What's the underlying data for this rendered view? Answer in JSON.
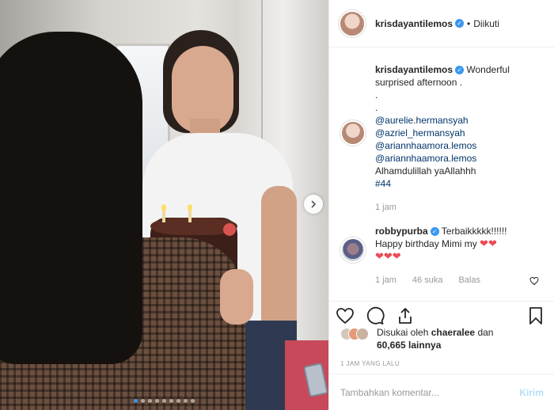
{
  "post": {
    "author": "krisdayantilemos",
    "separator": "•",
    "follow_status": "Diikuti"
  },
  "caption": {
    "author": "krisdayantilemos",
    "text": "Wonderful surprised afternoon .",
    "dot1": ".",
    "dot2": ".",
    "mentions": [
      "@aurelie.hermansyah",
      "@azriel_hermansyah",
      "@ariannhaamora.lemos",
      "@ariannhaamora.lemos"
    ],
    "line_after": "Alhamdulillah yaAllahhh",
    "hashtag": "#44",
    "time": "1 jam"
  },
  "comment": {
    "author": "robbypurba",
    "text1": "Terbaikkkkk!!!!!!",
    "text2": "Happy birthday Mimi my",
    "hearts_inline": "❤❤",
    "hearts_line": "❤❤❤",
    "time": "1 jam",
    "likes": "46 suka",
    "reply": "Balas"
  },
  "likes": {
    "prefix": "Disukai oleh",
    "user": "chaeralee",
    "joiner": "dan",
    "count": "60,665 lainnya"
  },
  "date_label": "1 JAM YANG LALU",
  "add_comment": {
    "placeholder": "Tambahkan komentar...",
    "post_label": "Kirim"
  },
  "carousel": {
    "count": 9,
    "active_index": 0
  },
  "colors": {
    "link": "#003569",
    "verified": "#3897f0",
    "heart": "#ed4956",
    "post_disabled": "#b2dffc"
  }
}
